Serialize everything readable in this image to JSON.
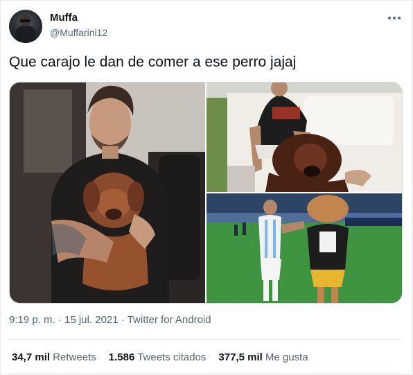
{
  "author": {
    "display_name": "Muffa",
    "handle": "@Muffarini12"
  },
  "tweet": {
    "text": "Que carajo le dan de comer a ese perro jajaj"
  },
  "media": {
    "images": [
      {
        "alt": "man holding a puppy"
      },
      {
        "alt": "man sitting with a large dog"
      },
      {
        "alt": "player next to a mascot on a football pitch"
      }
    ]
  },
  "meta": {
    "time": "9:19 p. m.",
    "date": "15 jul. 2021",
    "source": "Twitter for Android",
    "separator": "·"
  },
  "stats": {
    "retweets_count": "34,7 mil",
    "retweets_label": "Retweets",
    "quotes_count": "1.586",
    "quotes_label": "Tweets citados",
    "likes_count": "377,5 mil",
    "likes_label": "Me gusta"
  },
  "colors": {
    "text_primary": "#0f1419",
    "text_secondary": "#536471",
    "border": "#cfd9de"
  },
  "icons": [
    "more-icon"
  ]
}
